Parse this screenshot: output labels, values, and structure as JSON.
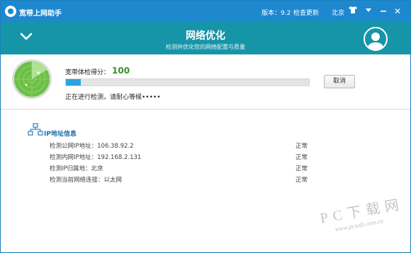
{
  "app": {
    "title": "宽带上网助手",
    "version": "版本：9.2",
    "update_label": "检查更新",
    "city": "北京",
    "shirt_icon": "shirt-icon",
    "menu_icon": "chevron-down-icon",
    "minimize_icon": "minimize-icon",
    "close_glyph": "✕"
  },
  "header": {
    "title": "网络优化",
    "subtitle": "检测并优化您的网络配置与质量"
  },
  "scan": {
    "score_label": "宽带体检得分：",
    "score_value": "100",
    "progress_percent": 6,
    "status_text": "正在进行检测，请耐心等候•••••",
    "cancel_label": "取消"
  },
  "ip_section": {
    "title": "IP地址信息",
    "rows": [
      {
        "label": "检测公网IP地址：106.38.92.2",
        "status": "正常"
      },
      {
        "label": "检测内网IP地址：192.168.2.131",
        "status": "正常"
      },
      {
        "label": "检测IP归属地：北京",
        "status": "正常"
      },
      {
        "label": "检测当前网络连接：以太网",
        "status": "正常"
      }
    ]
  },
  "watermark": {
    "text": "PC下载网",
    "url": "www.pcsoft.com.cn"
  },
  "colors": {
    "titlebar": "#1e88cf",
    "subheader": "#1795a8",
    "progress": "#2aa3e0",
    "score": "#3a8f2a",
    "radar": "#5cb83a"
  }
}
